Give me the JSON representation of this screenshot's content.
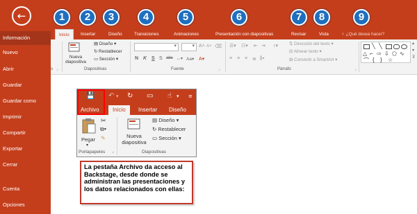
{
  "colors": {
    "accent": "#c43e1c",
    "badge": "#1e6fbf",
    "highlight_border": "#ff0000"
  },
  "backstage": {
    "back_icon": "←",
    "items": [
      "Información",
      "Nuevo",
      "Abrir",
      "Guardar",
      "Guardar como",
      "Imprimir",
      "Compartir",
      "Exportar",
      "Cerrar",
      "Cuenta",
      "Opciones"
    ],
    "active": "Información"
  },
  "ribbon": {
    "tabs": [
      "Inicio",
      "Insertar",
      "Diseño",
      "Transiciones",
      "Animaciones",
      "Presentación con diapositivas",
      "Revisar",
      "Vista"
    ],
    "active_tab": "Inicio",
    "tell_me": "¿Qué desea hacer?",
    "badges": [
      "1",
      "2",
      "3",
      "4",
      "5",
      "6",
      "7",
      "8",
      "9"
    ],
    "groups": {
      "clipboard_partial": "s",
      "slides": {
        "label": "Diapositivas",
        "new_slide": "Nueva diapositiva",
        "layout": "Diseño",
        "reset": "Restablecer",
        "section": "Sección"
      },
      "font": {
        "label": "Fuente",
        "bold": "N",
        "italic": "K",
        "underline": "S",
        "strike": "S",
        "spacing": "abc",
        "case": "Aa",
        "grow": "A",
        "shrink": "A"
      },
      "paragraph": {
        "label": "Párrafo",
        "text_direction": "Dirección del texto",
        "align_text": "Alinear texto",
        "smartart": "Convertir a SmartArt"
      }
    }
  },
  "inset": {
    "tabs": [
      "Archivo",
      "Inicio",
      "Insertar",
      "Diseño"
    ],
    "active_tab": "Inicio",
    "paste": "Pegar",
    "clipboard_label": "Portapapeles",
    "new_slide": "Nueva diapositiva",
    "layout": "Diseño",
    "reset": "Restablecer",
    "section": "Sección",
    "slides_label": "Diapositivas"
  },
  "callout": {
    "text": "La pestaña Archivo da acceso al Backstage, desde donde se administran las presentaciones y los datos relacionados con ellas:"
  }
}
